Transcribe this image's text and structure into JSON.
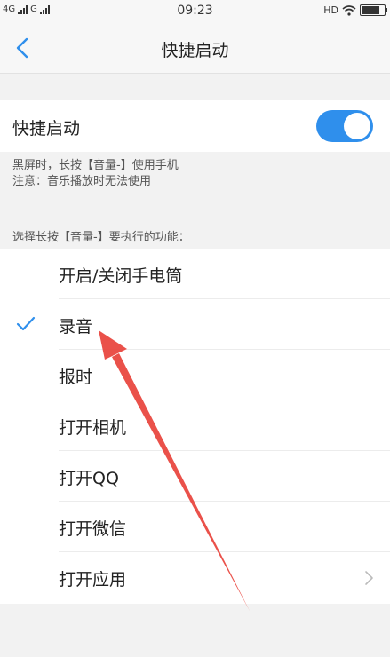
{
  "status_bar": {
    "network_1": "4G",
    "network_2": "G",
    "time": "09:23",
    "hd": "HD",
    "icons": [
      "signal-icon",
      "wifi-icon",
      "battery-icon"
    ]
  },
  "header": {
    "title": "快捷启动",
    "back_icon": "chevron-left-icon"
  },
  "toggle": {
    "label": "快捷启动",
    "state": "on",
    "accent_color": "#2f8fec"
  },
  "description": {
    "line1": "黑屏时，长按【音量-】使用手机",
    "line2": "注意：音乐播放时无法使用"
  },
  "function_section": {
    "label": "选择长按【音量-】要执行的功能："
  },
  "options": [
    {
      "label": "开启/关闭手电筒",
      "selected": false
    },
    {
      "label": "录音",
      "selected": true
    },
    {
      "label": "报时",
      "selected": false
    },
    {
      "label": "打开相机",
      "selected": false
    },
    {
      "label": "打开QQ",
      "selected": false
    },
    {
      "label": "打开微信",
      "selected": false
    },
    {
      "label": "打开应用",
      "selected": false,
      "has_chevron": true
    }
  ],
  "annotation": {
    "color": "#e8423b"
  }
}
